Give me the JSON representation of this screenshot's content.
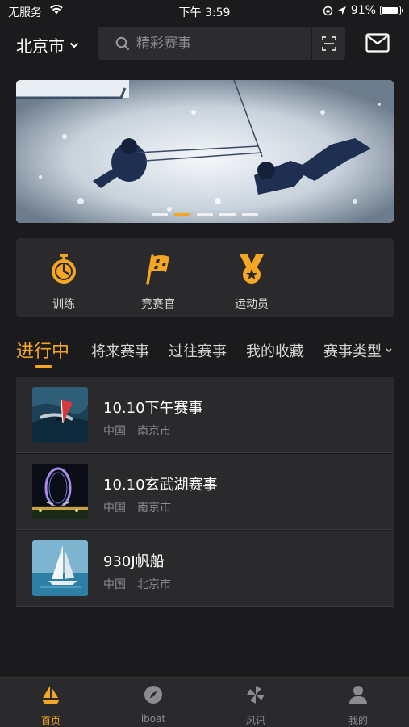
{
  "status_bar": {
    "carrier": "无服务",
    "time": "下午 3:59",
    "battery": "91%",
    "battery_level": 0.91
  },
  "header": {
    "city": "北京市",
    "search_placeholder": "精彩赛事"
  },
  "banner": {
    "slide_count": 5,
    "active_slide": 1
  },
  "categories": [
    {
      "label": "训练",
      "icon": "stopwatch-icon"
    },
    {
      "label": "竞赛官",
      "icon": "flag-icon"
    },
    {
      "label": "运动员",
      "icon": "medal-icon"
    }
  ],
  "tabs": [
    "进行中",
    "将来赛事",
    "过往赛事",
    "我的收藏",
    "赛事类型"
  ],
  "events": [
    {
      "title": "10.10下午赛事",
      "country": "中国",
      "city": "南京市",
      "thumb": "windsurf"
    },
    {
      "title": "10.10玄武湖赛事",
      "country": "中国",
      "city": "南京市",
      "thumb": "ferris-wheel"
    },
    {
      "title": "930J帆船",
      "country": "中国",
      "city": "北京市",
      "thumb": "sailboat"
    }
  ],
  "bottom_nav": [
    {
      "label": "首页",
      "icon": "sailboat-home-icon",
      "active": true
    },
    {
      "label": "iboat",
      "icon": "compass-icon",
      "active": false
    },
    {
      "label": "风讯",
      "icon": "pinwheel-icon",
      "active": false
    },
    {
      "label": "我的",
      "icon": "user-icon",
      "active": false
    }
  ],
  "colors": {
    "accent": "#f5a623",
    "background": "#1b1b1d",
    "card": "#2a2a2d"
  }
}
